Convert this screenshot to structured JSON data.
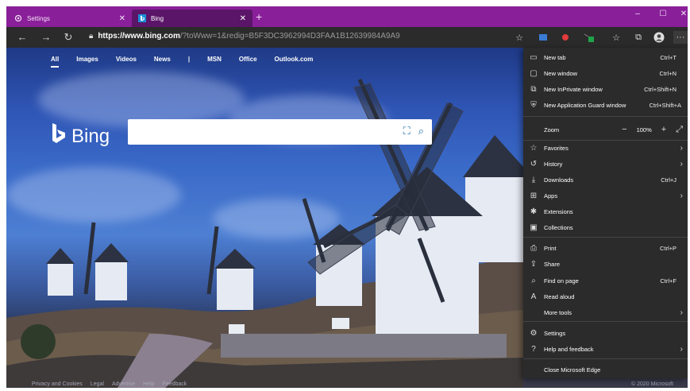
{
  "tabs": [
    {
      "title": "Settings",
      "icon": "gear-icon",
      "active": false
    },
    {
      "title": "Bing",
      "icon": "bing-icon",
      "active": true
    }
  ],
  "new_tab_symbol": "+",
  "window_controls": {
    "minimize": "–",
    "maximize": "☐",
    "close": "✕"
  },
  "address": {
    "host": "https://www.bing.com",
    "rest": "/?toWww=1&redig=B5F3DC3962994D3FAA1B12639984A9A9"
  },
  "bing": {
    "nav": [
      "All",
      "Images",
      "Videos",
      "News",
      "|",
      "MSN",
      "Office",
      "Outlook.com"
    ],
    "logo_text": "Bing",
    "footer_links": [
      "Privacy and Cookies",
      "Legal",
      "Advertise",
      "Help",
      "Feedback"
    ],
    "copyright": "© 2020 Microsoft"
  },
  "menu": {
    "items": [
      {
        "icon": "new-tab-icon",
        "glyph": "▭",
        "label": "New tab",
        "shortcut": "Ctrl+T"
      },
      {
        "icon": "new-window-icon",
        "glyph": "▢",
        "label": "New window",
        "shortcut": "Ctrl+N"
      },
      {
        "icon": "inprivate-icon",
        "glyph": "⧉",
        "label": "New InPrivate window",
        "shortcut": "Ctrl+Shift+N"
      },
      {
        "icon": "app-guard-icon",
        "glyph": "⛨",
        "label": "New Application Guard window",
        "shortcut": "Ctrl+Shift+A"
      }
    ],
    "zoom": {
      "label": "Zoom",
      "value": "100%"
    },
    "items2": [
      {
        "icon": "favorites-icon",
        "glyph": "☆",
        "label": "Favorites",
        "shortcut": "",
        "arrow": "›"
      },
      {
        "icon": "history-icon",
        "glyph": "↺",
        "label": "History",
        "shortcut": "",
        "arrow": "›"
      },
      {
        "icon": "downloads-icon",
        "glyph": "⤓",
        "label": "Downloads",
        "shortcut": "Ctrl+J",
        "arrow": ""
      },
      {
        "icon": "apps-icon",
        "glyph": "⊞",
        "label": "Apps",
        "shortcut": "",
        "arrow": "›"
      },
      {
        "icon": "extensions-icon",
        "glyph": "✱",
        "label": "Extensions",
        "shortcut": "",
        "arrow": ""
      },
      {
        "icon": "collections-icon",
        "glyph": "▣",
        "label": "Collections",
        "shortcut": "",
        "arrow": ""
      }
    ],
    "items3": [
      {
        "icon": "print-icon",
        "glyph": "⎙",
        "label": "Print",
        "shortcut": "Ctrl+P",
        "arrow": ""
      },
      {
        "icon": "share-icon",
        "glyph": "⇪",
        "label": "Share",
        "shortcut": "",
        "arrow": ""
      },
      {
        "icon": "find-icon",
        "glyph": "⌕",
        "label": "Find on page",
        "shortcut": "Ctrl+F",
        "arrow": ""
      },
      {
        "icon": "read-aloud-icon",
        "glyph": "A",
        "label": "Read aloud",
        "shortcut": "",
        "arrow": ""
      },
      {
        "icon": "",
        "glyph": "",
        "label": "More tools",
        "shortcut": "",
        "arrow": "›"
      }
    ],
    "items4": [
      {
        "icon": "settings-icon",
        "glyph": "⚙",
        "label": "Settings",
        "shortcut": "",
        "arrow": ""
      },
      {
        "icon": "help-icon",
        "glyph": "?",
        "label": "Help and feedback",
        "shortcut": "",
        "arrow": "›"
      }
    ],
    "close_label": "Close Microsoft Edge"
  }
}
